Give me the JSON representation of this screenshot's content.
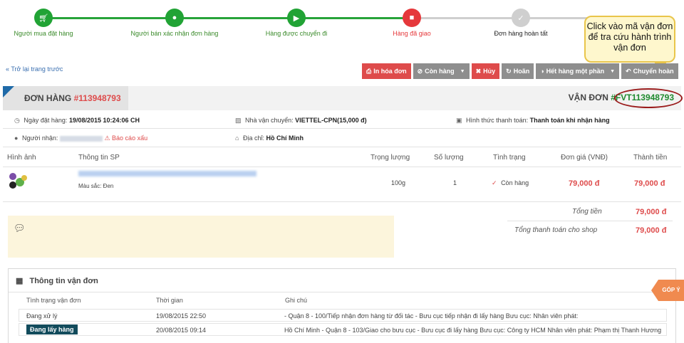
{
  "steps": [
    {
      "label": "Người mua đặt hàng",
      "icon": "cart-icon",
      "status": "done"
    },
    {
      "label": "Người bán xác nhận đơn hàng",
      "icon": "user-icon",
      "status": "done"
    },
    {
      "label": "Hàng được chuyển đi",
      "icon": "truck-icon",
      "status": "done"
    },
    {
      "label": "Hàng đã giao",
      "icon": "gift-icon",
      "status": "current"
    },
    {
      "label": "Đơn hàng hoàn tất",
      "icon": "check-icon",
      "status": "pending"
    }
  ],
  "callout": {
    "text": "Click vào mã vận đơn để tra cứu hành trình vận đơn"
  },
  "back_link": "« Trở lại trang trước",
  "toolbar": {
    "print": "In hóa đơn",
    "in_stock": "Còn hàng",
    "cancel": "Hủy",
    "postpone": "Hoãn",
    "out_of_stock": "Hết hàng một phần",
    "transfer": "Chuyển hoàn"
  },
  "order": {
    "title_prefix": "ĐƠN HÀNG",
    "number": "#113948793",
    "waybill_label": "VẬN ĐƠN",
    "waybill_code": "#FVT113948793",
    "date_label": "Ngày đặt hàng:",
    "date_value": "19/08/2015 10:24:06 CH",
    "carrier_label": "Nhà vận chuyển:",
    "carrier_value": "VIETTEL-CPN(15,000 đ)",
    "payment_label": "Hình thức thanh toán:",
    "payment_value": "Thanh toán khi nhận hàng",
    "receiver_label": "Người nhận:",
    "report_bad": "Báo cáo xấu",
    "address_label": "Địa chỉ:",
    "address_value": "Hồ Chí Minh"
  },
  "table": {
    "headers": [
      "Hình ảnh",
      "Thông tin SP",
      "Trọng lượng",
      "Số lượng",
      "Tình trạng",
      "Đơn giá (VNĐ)",
      "Thành tiền"
    ],
    "row": {
      "color": "Màu sắc: Đen",
      "weight": "100g",
      "quantity": "1",
      "status": "Còn hàng",
      "unit_price": "79,000 đ",
      "total": "79,000 đ"
    }
  },
  "totals": {
    "total_label": "Tổng tiền",
    "total_value": "79,000 đ",
    "shop_label": "Tổng thanh toán cho shop",
    "shop_value": "79,000 đ"
  },
  "shipping": {
    "title": "Thông tin vận đơn",
    "headers": [
      "Tình trạng vận đơn",
      "Thời gian",
      "Ghi chú"
    ],
    "rows": [
      {
        "status": "Đang xử lý",
        "time": "19/08/2015 22:50",
        "note": "- Quận 8 - 100/Tiếp nhận đơn hàng từ đối tác - Bưu cục tiếp nhận đi lấy hàng Bưu cục: Nhân viên phát:"
      },
      {
        "status": "Đang lấy hàng",
        "time": "20/08/2015 09:14",
        "note": "Hồ Chí Minh - Quận 8 - 103/Giao cho bưu cục - Bưu cục đi lấy hàng Bưu cục: Công ty HCM Nhân viên phát: Phạm thị Thanh Hương"
      }
    ]
  },
  "feedback": "GÓP Ý"
}
